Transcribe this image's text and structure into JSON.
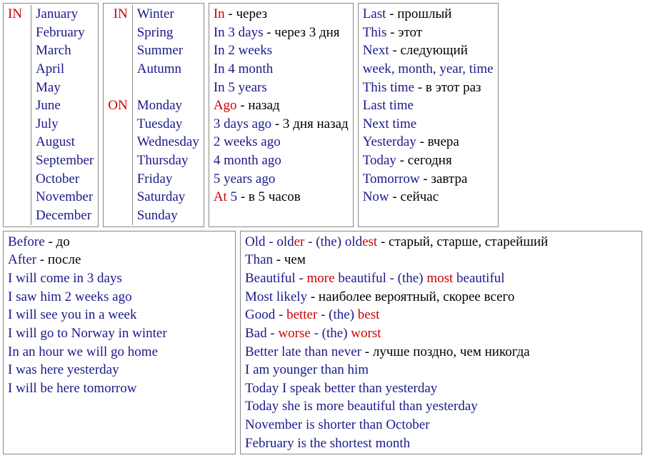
{
  "col1": {
    "prep": "IN",
    "items": [
      "January",
      "February",
      "March",
      "April",
      "May",
      "June",
      "July",
      "August",
      "September",
      "October",
      "November",
      "December"
    ]
  },
  "col2": {
    "prep1": "IN",
    "seasons": [
      "Winter",
      "Spring",
      "Summer",
      "Autumn"
    ],
    "prep2": "ON",
    "days": [
      "Monday",
      "Tuesday",
      "Wednesday",
      "Thursday",
      "Friday",
      "Saturday",
      "Sunday"
    ]
  },
  "col3": {
    "l0": {
      "w": "In",
      "t": " - через"
    },
    "l1": {
      "w": "In 3 days",
      "t": " - через 3 дня"
    },
    "l2": {
      "w": "In 2 weeks"
    },
    "l3": {
      "w": "In 4 month"
    },
    "l4": {
      "w": "In 5 years"
    },
    "l5": {
      "w": "Ago",
      "t": " - назад"
    },
    "l6": {
      "w": "3 days ago",
      "t": " - 3 дня назад"
    },
    "l7": {
      "w": "2 weeks ago"
    },
    "l8": {
      "w": "4 month ago"
    },
    "l9": {
      "w": "5 years ago"
    },
    "l10": {
      "w": "At",
      "b": " 5",
      "t": " - в 5 часов"
    }
  },
  "col4": {
    "l0": {
      "w": "Last",
      "t": " - прошлый"
    },
    "l1": {
      "w": "This",
      "t": " - этот"
    },
    "l2": {
      "w": "Next",
      "t": " - следующий"
    },
    "l3": {
      "w": "week, month, year, time"
    },
    "l4": {
      "w": "This time",
      "t": " - в этот раз"
    },
    "l5": {
      "w": "Last time"
    },
    "l6": {
      "w": "Next time"
    },
    "l7": {
      "w": "Yesterday",
      "t": " - вчера"
    },
    "l8": {
      "w": "Today",
      "t": " - сегодня"
    },
    "l9": {
      "w": "Tomorrow",
      "t": " - завтра"
    },
    "l10": {
      "w": "Now",
      "t": " - сейчас"
    }
  },
  "box5": {
    "l0": {
      "w": "Before",
      "t": " - до"
    },
    "l1": {
      "w": "After",
      "t": " - после"
    },
    "l2": "I will come in 3 days",
    "l3": "I saw him 2 weeks ago",
    "l4": "I will see you in a week",
    "l5": "I will go to Norway in winter",
    "l6": "In an hour we will go home",
    "l7": "I was here yesterday",
    "l8": "I will be here tomorrow"
  },
  "box6": {
    "l0": {
      "a": "Old",
      "b": " - old",
      "c": "er",
      "d": " - (the) old",
      "e": "est",
      "t": " - старый, старше, старейший"
    },
    "l1": {
      "w": "Than",
      "t": " - чем"
    },
    "l2": {
      "a": "Beautiful - ",
      "b": "more",
      "c": " beautiful - (the) ",
      "d": "most",
      "e": " beautiful"
    },
    "l3": {
      "w": "Most likely",
      "t": " - наиболее вероятный, скорее всего"
    },
    "l4": {
      "a": "Good - ",
      "b": "better",
      "c": " - (the) ",
      "d": "best"
    },
    "l5": {
      "a": "Bad - ",
      "b": "worse",
      "c": " - (the) ",
      "d": "worst"
    },
    "l6": {
      "w": "Better late than never",
      "t": " - лучше поздно, чем никогда"
    },
    "l7": "I am younger than him",
    "l8": "Today I speak better than yesterday",
    "l9": "Today she is more beautiful than yesterday",
    "l10": "November is shorter than October",
    "l11": "February is the shortest month"
  }
}
